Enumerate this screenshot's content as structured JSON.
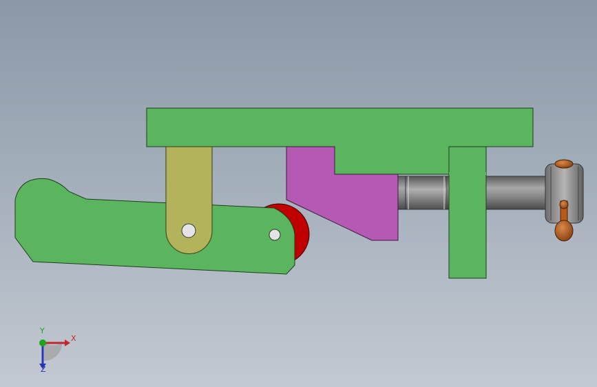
{
  "viewport": {
    "background_top": "#8c98a6",
    "background_bottom": "#c3c9d1"
  },
  "parts": {
    "frame_color": "#5ab55e",
    "lever_color": "#5ab55e",
    "link_color": "#b3b35c",
    "wedge_color": "#b45ab4",
    "roller_color": "#c00000",
    "shaft_color": "#808080",
    "nut_color": "#b85a1a"
  },
  "triad": {
    "x_label": "X",
    "y_label": "Y",
    "z_label": "Z",
    "x_color": "#c0262c",
    "y_color": "#1aa51a",
    "z_color": "#2834b4"
  }
}
